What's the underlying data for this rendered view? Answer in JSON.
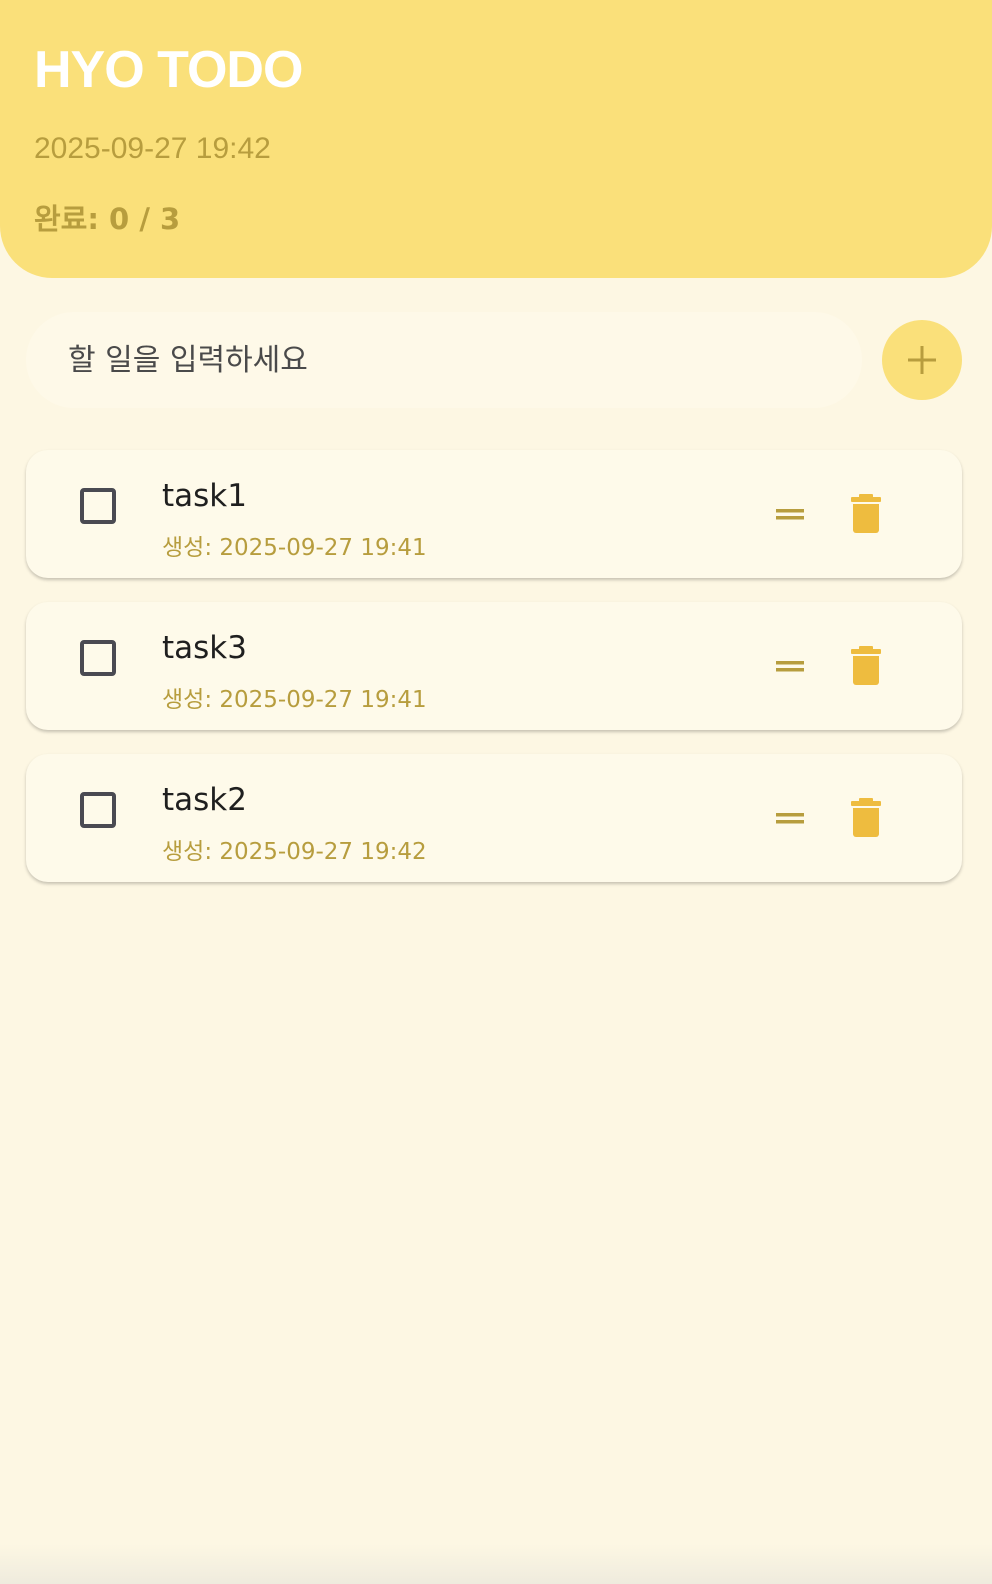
{
  "header": {
    "title": "HYO TODO",
    "datetime": "2025-09-27 19:42",
    "completion": "완료: 0 / 3"
  },
  "input": {
    "placeholder": "할 일을 입력하세요",
    "value": "",
    "add_icon": "plus-icon"
  },
  "tasks": [
    {
      "title": "task1",
      "created": "생성: 2025-09-27 19:41",
      "checked": false
    },
    {
      "title": "task3",
      "created": "생성: 2025-09-27 19:41",
      "checked": false
    },
    {
      "title": "task2",
      "created": "생성: 2025-09-27 19:42",
      "checked": false
    }
  ],
  "icons": {
    "checkbox": "checkbox-unchecked-icon",
    "drag": "drag-handle-icon",
    "delete": "trash-icon"
  },
  "colors": {
    "header_bg": "#FAE07A",
    "background": "#FDF7E3",
    "accent_text": "#B79D3E",
    "trash": "#EEBC3F",
    "card_bg": "#FEFAEA"
  }
}
